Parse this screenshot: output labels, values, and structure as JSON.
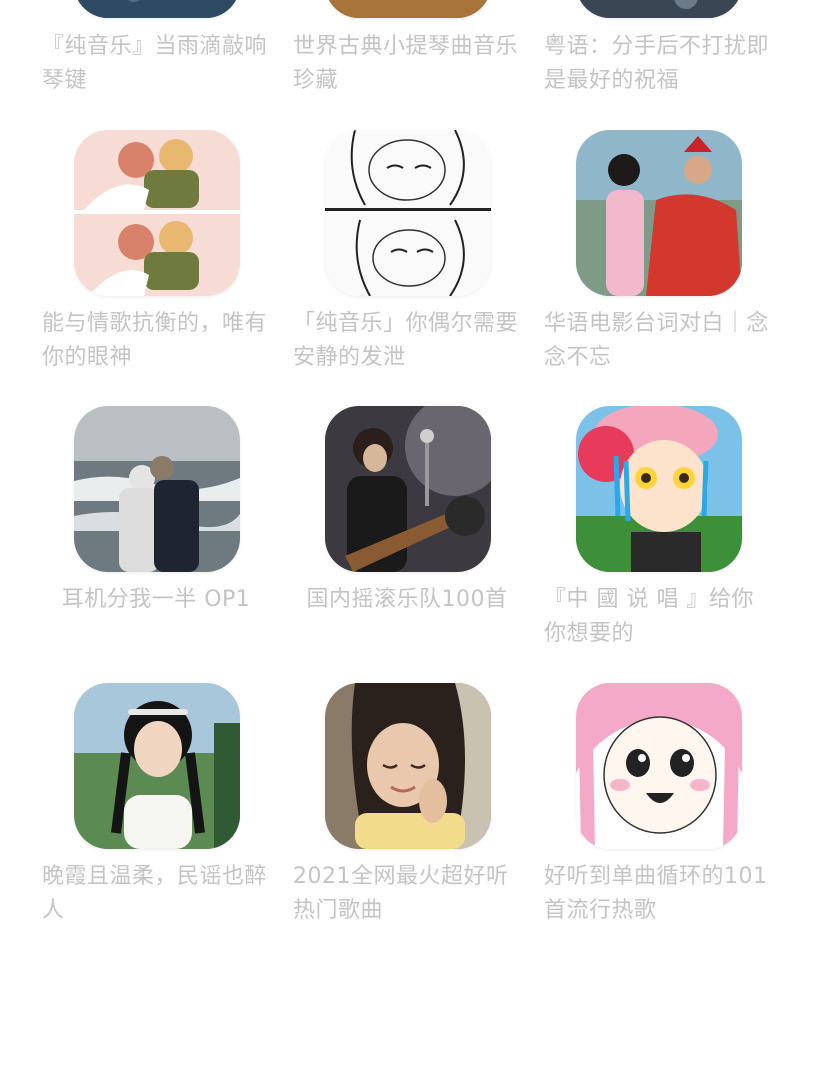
{
  "playlists": [
    {
      "title": "『纯音乐』当雨滴敲响琴键",
      "cover": "rain-piano-cover",
      "accent": "#2f4a63"
    },
    {
      "title": "世界古典小提琴曲音乐珍藏",
      "cover": "violin-cover",
      "accent": "#a8743a"
    },
    {
      "title": "粤语：分手后不打扰即是最好的祝福",
      "cover": "cantonese-cover",
      "accent": "#3a4654"
    },
    {
      "title": "能与情歌抗衡的，唯有你的眼神",
      "cover": "couple-illustration-cover",
      "accent": "#f3c9c4"
    },
    {
      "title": "「纯音乐」你偶尔需要安静的发泄",
      "cover": "manga-crying-cover",
      "accent": "#e9e9e9"
    },
    {
      "title": "华语电影台词对白｜念念不忘",
      "cover": "movie-scene-cover",
      "accent": "#d3372e"
    },
    {
      "title": "耳机分我一半 OP1",
      "cover": "seaside-couple-cover",
      "accent": "#9aa4a8"
    },
    {
      "title": "国内摇滚乐队100首",
      "cover": "guitarist-cover",
      "accent": "#5a5560"
    },
    {
      "title": "『中 國 说 唱 』给你你想要的",
      "cover": "kirby-anime-cover",
      "accent": "#f08aa8"
    },
    {
      "title": "晚霞且温柔，民谣也醉人",
      "cover": "braided-girl-cover",
      "accent": "#6a9a6a"
    },
    {
      "title": "2021全网最火超好听热门歌曲",
      "cover": "smiling-girl-cover",
      "accent": "#c9a58a"
    },
    {
      "title": "好听到单曲循环的101首流行热歌",
      "cover": "pink-hair-manga-cover",
      "accent": "#f5a9c9"
    }
  ]
}
